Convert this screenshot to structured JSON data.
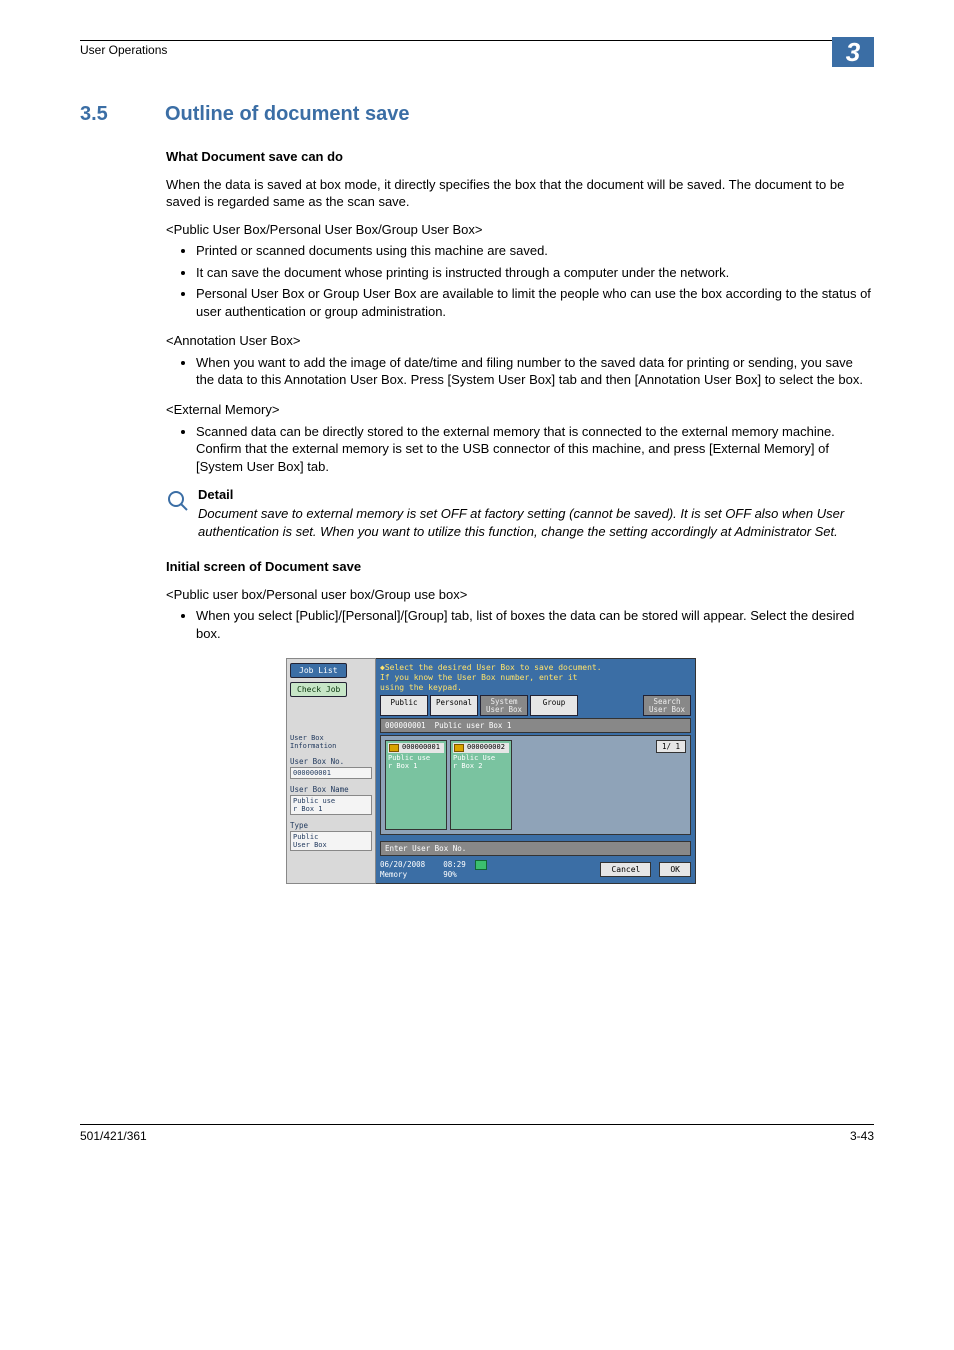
{
  "header": {
    "category": "User Operations",
    "chapter_number": "3"
  },
  "section": {
    "number": "3.5",
    "title": "Outline of document save"
  },
  "h_what": "What Document save can do",
  "p_intro": "When the data is saved at box mode, it directly specifies the box that the document will be saved. The document to be saved is regarded same as the scan save.",
  "p_box_types": "<Public User Box/Personal User Box/Group User Box>",
  "bullets_1": [
    "Printed or scanned documents using this machine are saved.",
    "It can save the document whose printing is instructed through a computer under the network.",
    "Personal User Box or Group User Box are available to limit the people who can use the box according to the status of user authentication or group administration."
  ],
  "p_annotation": "<Annotation User Box>",
  "bullets_2": [
    "When you want to add the image of date/time and filing number to the saved data for printing or sending, you save the data to this Annotation User Box. Press [System User Box] tab and then [Annotation User Box] to select the box."
  ],
  "p_external": "<External Memory>",
  "bullets_3": [
    "Scanned data can be directly stored to the external memory that is connected to the external memory machine. Confirm that the external memory is set to the USB connector of this machine, and press [External Memory] of [System User Box] tab."
  ],
  "detail": {
    "label": "Detail",
    "body": "Document save to external memory is set OFF at factory setting (cannot be saved). It is set OFF also when User authentication is set. When you want to utilize this function, change the setting accordingly at Administrator Set."
  },
  "h_initial": "Initial screen of Document save",
  "p_initial_sub": "<Public user box/Personal user box/Group use box>",
  "bullets_4": [
    "When you select [Public]/[Personal]/[Group] tab, list of boxes the data can be stored will appear. Select the desired box."
  ],
  "screenshot": {
    "job_list": "Job List",
    "check_job": "Check Job",
    "hint": "Select the desired User Box to save document.\nIf you know the User Box number, enter it\nusing the keypad.",
    "tabs": [
      "Public",
      "Personal",
      "System\nUser Box",
      "Group"
    ],
    "search_tab": "Search\nUser Box",
    "breadcrumb_num": "000000001",
    "breadcrumb_name": "Public user Box 1",
    "boxes": [
      {
        "num": "000000001",
        "name": "Public use\nr Box 1"
      },
      {
        "num": "000000002",
        "name": "Public Use\nr Box 2"
      }
    ],
    "pager": "1/  1",
    "enter": "Enter User Box No.",
    "date": "06/20/2008",
    "time": "08:29",
    "memory_label": "Memory",
    "memory_pct": "90%",
    "cancel": "Cancel",
    "ok": "OK",
    "left": {
      "info_title": "User Box\nInformation",
      "no_label": "User Box No.",
      "no_value": "000000001",
      "name_label": "User Box Name",
      "name_value": "Public use\nr Box 1",
      "type_label": "Type",
      "type_value": "Public\nUser Box"
    }
  },
  "footer": {
    "left": "501/421/361",
    "right": "3-43"
  }
}
